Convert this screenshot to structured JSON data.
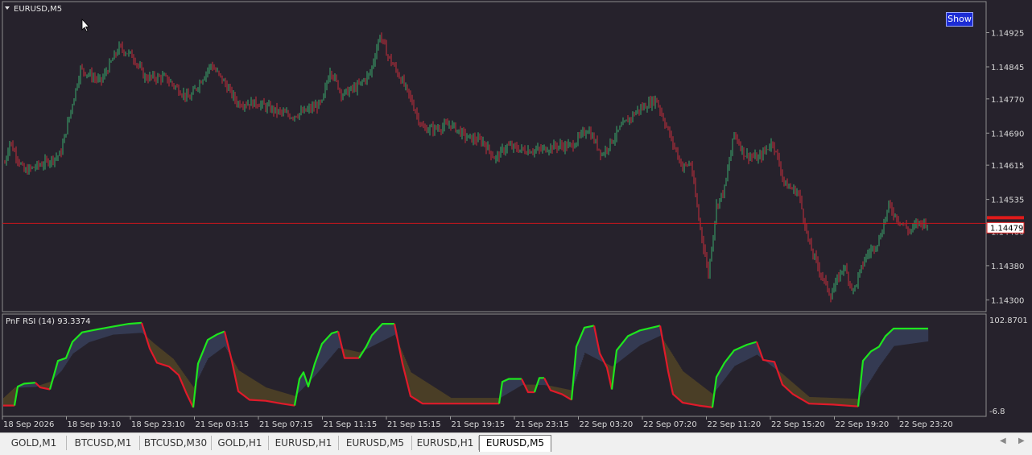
{
  "chart_title": "EURUSD,M5",
  "show_button_label": "Show",
  "indicator_label": "PnF RSI (14) 93.3374",
  "current_price_label": "1.14479",
  "colors": {
    "background": "#26222c",
    "candle_up": "#3aa86b",
    "candle_down": "#c62d3b",
    "price_line": "#c8161d",
    "rsi_up": "#1ee61e",
    "rsi_down": "#e01a2a",
    "fill_up": "#343a52",
    "fill_down": "#4a3e26"
  },
  "chart_data": [
    {
      "type": "candlestick",
      "price_axis_ticks": [
        "1.14925",
        "1.14845",
        "1.14770",
        "1.14690",
        "1.14615",
        "1.14535",
        "1.14460",
        "1.14380",
        "1.14300"
      ],
      "ylim": [
        1.1428,
        1.1499
      ],
      "current_price": 1.14479,
      "x_ticks": [
        "18 Sep 2026",
        "18 Sep 19:10",
        "18 Sep 23:10",
        "21 Sep 03:15",
        "21 Sep 07:15",
        "21 Sep 11:15",
        "21 Sep 15:15",
        "21 Sep 19:15",
        "21 Sep 23:15",
        "22 Sep 03:20",
        "22 Sep 07:20",
        "22 Sep 11:20",
        "22 Sep 15:20",
        "22 Sep 19:20",
        "22 Sep 23:20"
      ],
      "path": [
        [
          0,
          1.1457
        ],
        [
          12,
          1.1467
        ],
        [
          30,
          1.146
        ],
        [
          55,
          1.1462
        ],
        [
          75,
          1.1464
        ],
        [
          100,
          1.1484
        ],
        [
          125,
          1.1481
        ],
        [
          148,
          1.1489
        ],
        [
          165,
          1.1487
        ],
        [
          180,
          1.1482
        ],
        [
          205,
          1.1482
        ],
        [
          235,
          1.1477
        ],
        [
          262,
          1.1485
        ],
        [
          278,
          1.1481
        ],
        [
          295,
          1.1476
        ],
        [
          320,
          1.1476
        ],
        [
          345,
          1.1474
        ],
        [
          362,
          1.1473
        ],
        [
          378,
          1.1474
        ],
        [
          400,
          1.1476
        ],
        [
          410,
          1.1484
        ],
        [
          425,
          1.1478
        ],
        [
          445,
          1.148
        ],
        [
          460,
          1.1483
        ],
        [
          472,
          1.1492
        ],
        [
          482,
          1.1487
        ],
        [
          500,
          1.1481
        ],
        [
          510,
          1.1477
        ],
        [
          525,
          1.147
        ],
        [
          540,
          1.147
        ],
        [
          560,
          1.1471
        ],
        [
          580,
          1.1468
        ],
        [
          600,
          1.1467
        ],
        [
          615,
          1.1463
        ],
        [
          630,
          1.1466
        ],
        [
          650,
          1.1465
        ],
        [
          670,
          1.1465
        ],
        [
          690,
          1.1466
        ],
        [
          710,
          1.1466
        ],
        [
          730,
          1.147
        ],
        [
          748,
          1.1464
        ],
        [
          770,
          1.147
        ],
        [
          790,
          1.1474
        ],
        [
          815,
          1.1477
        ],
        [
          835,
          1.1467
        ],
        [
          848,
          1.1461
        ],
        [
          858,
          1.1462
        ],
        [
          868,
          1.1449
        ],
        [
          880,
          1.1436
        ],
        [
          890,
          1.1452
        ],
        [
          900,
          1.1456
        ],
        [
          912,
          1.1469
        ],
        [
          925,
          1.1464
        ],
        [
          942,
          1.1463
        ],
        [
          960,
          1.1467
        ],
        [
          975,
          1.1457
        ],
        [
          992,
          1.1455
        ],
        [
          1005,
          1.1443
        ],
        [
          1020,
          1.1436
        ],
        [
          1032,
          1.1431
        ],
        [
          1048,
          1.1438
        ],
        [
          1060,
          1.1432
        ],
        [
          1075,
          1.144
        ],
        [
          1092,
          1.1444
        ],
        [
          1104,
          1.1452
        ],
        [
          1115,
          1.1449
        ],
        [
          1130,
          1.1446
        ],
        [
          1140,
          1.1448
        ],
        [
          1152,
          1.1448
        ]
      ]
    },
    {
      "type": "line",
      "title": "PnF RSI (14) 93.3374",
      "y_axis_ticks": [
        "102.8701",
        "-6.8"
      ],
      "ylim": [
        0,
        100
      ],
      "segments": [
        {
          "d": "down",
          "pts": [
            [
              4,
              8
            ],
            [
              18,
              8
            ]
          ]
        },
        {
          "d": "up",
          "pts": [
            [
              18,
              8
            ],
            [
              22,
              28
            ],
            [
              30,
              31
            ],
            [
              44,
              32
            ]
          ]
        },
        {
          "d": "down",
          "pts": [
            [
              44,
              32
            ],
            [
              50,
              27
            ],
            [
              62,
              25
            ]
          ]
        },
        {
          "d": "up",
          "pts": [
            [
              62,
              25
            ],
            [
              72,
              55
            ],
            [
              82,
              58
            ],
            [
              90,
              75
            ],
            [
              102,
              85
            ],
            [
              120,
              88
            ],
            [
              140,
              91
            ],
            [
              160,
              94
            ],
            [
              176,
              95
            ]
          ]
        },
        {
          "d": "down",
          "pts": [
            [
              176,
              95
            ],
            [
              186,
              68
            ],
            [
              195,
              53
            ],
            [
              210,
              49
            ],
            [
              222,
              40
            ],
            [
              232,
              20
            ],
            [
              240,
              6
            ]
          ]
        },
        {
          "d": "up",
          "pts": [
            [
              240,
              6
            ],
            [
              246,
              52
            ],
            [
              258,
              77
            ],
            [
              270,
              83
            ],
            [
              279,
              86
            ]
          ]
        },
        {
          "d": "down",
          "pts": [
            [
              279,
              86
            ],
            [
              288,
              55
            ],
            [
              296,
              23
            ],
            [
              310,
              14
            ],
            [
              330,
              13
            ],
            [
              350,
              10
            ],
            [
              366,
              8
            ]
          ]
        },
        {
          "d": "up",
          "pts": [
            [
              366,
              8
            ],
            [
              372,
              36
            ],
            [
              377,
              43
            ],
            [
              383,
              28
            ],
            [
              391,
              52
            ],
            [
              400,
              73
            ],
            [
              412,
              84
            ],
            [
              420,
              86
            ]
          ]
        },
        {
          "d": "down",
          "pts": [
            [
              420,
              86
            ],
            [
              428,
              58
            ],
            [
              446,
              58
            ]
          ]
        },
        {
          "d": "up",
          "pts": [
            [
              446,
              58
            ],
            [
              455,
              70
            ],
            [
              462,
              82
            ],
            [
              475,
              94
            ],
            [
              490,
              94
            ]
          ]
        },
        {
          "d": "down",
          "pts": [
            [
              490,
              94
            ],
            [
              500,
              52
            ],
            [
              510,
              18
            ],
            [
              525,
              10
            ],
            [
              560,
              10
            ],
            [
              590,
              10
            ],
            [
              620,
              10
            ]
          ]
        },
        {
          "d": "up",
          "pts": [
            [
              620,
              10
            ],
            [
              624,
              33
            ],
            [
              632,
              36
            ],
            [
              648,
              36
            ]
          ]
        },
        {
          "d": "down",
          "pts": [
            [
              648,
              36
            ],
            [
              656,
              22
            ],
            [
              664,
              22
            ]
          ]
        },
        {
          "d": "up",
          "pts": [
            [
              664,
              22
            ],
            [
              670,
              37
            ],
            [
              676,
              37
            ]
          ]
        },
        {
          "d": "down",
          "pts": [
            [
              676,
              37
            ],
            [
              684,
              24
            ],
            [
              698,
              20
            ],
            [
              710,
              14
            ]
          ]
        },
        {
          "d": "up",
          "pts": [
            [
              710,
              14
            ],
            [
              716,
              70
            ],
            [
              726,
              90
            ],
            [
              738,
              92
            ]
          ]
        },
        {
          "d": "down",
          "pts": [
            [
              738,
              92
            ],
            [
              745,
              63
            ],
            [
              754,
              48
            ],
            [
              760,
              25
            ]
          ]
        },
        {
          "d": "up",
          "pts": [
            [
              760,
              25
            ],
            [
              766,
              66
            ],
            [
              780,
              81
            ],
            [
              795,
              87
            ],
            [
              820,
              92
            ]
          ]
        },
        {
          "d": "down",
          "pts": [
            [
              820,
              92
            ],
            [
              830,
              44
            ],
            [
              836,
              20
            ],
            [
              848,
              11
            ],
            [
              868,
              8
            ],
            [
              885,
              6
            ]
          ]
        },
        {
          "d": "up",
          "pts": [
            [
              885,
              6
            ],
            [
              890,
              38
            ],
            [
              900,
              53
            ],
            [
              912,
              66
            ],
            [
              928,
              72
            ],
            [
              940,
              75
            ]
          ]
        },
        {
          "d": "down",
          "pts": [
            [
              940,
              75
            ],
            [
              948,
              56
            ],
            [
              962,
              54
            ],
            [
              972,
              30
            ],
            [
              985,
              20
            ],
            [
              1005,
              10
            ],
            [
              1035,
              9
            ],
            [
              1066,
              7
            ]
          ]
        },
        {
          "d": "up",
          "pts": [
            [
              1066,
              7
            ],
            [
              1072,
              55
            ],
            [
              1082,
              65
            ],
            [
              1092,
              70
            ],
            [
              1100,
              81
            ],
            [
              1110,
              89
            ],
            [
              1153,
              89
            ]
          ]
        }
      ],
      "band": [
        [
          4,
          16
        ],
        [
          18,
          27
        ],
        [
          44,
          28
        ],
        [
          62,
          33
        ],
        [
          76,
          45
        ],
        [
          90,
          63
        ],
        [
          110,
          75
        ],
        [
          140,
          83
        ],
        [
          176,
          85
        ],
        [
          190,
          74
        ],
        [
          215,
          57
        ],
        [
          240,
          27
        ],
        [
          258,
          58
        ],
        [
          279,
          71
        ],
        [
          296,
          45
        ],
        [
          330,
          27
        ],
        [
          366,
          18
        ],
        [
          391,
          40
        ],
        [
          420,
          69
        ],
        [
          446,
          64
        ],
        [
          490,
          83
        ],
        [
          510,
          43
        ],
        [
          560,
          16
        ],
        [
          620,
          16
        ],
        [
          648,
          30
        ],
        [
          676,
          30
        ],
        [
          710,
          24
        ],
        [
          726,
          64
        ],
        [
          760,
          49
        ],
        [
          795,
          72
        ],
        [
          820,
          82
        ],
        [
          848,
          44
        ],
        [
          885,
          20
        ],
        [
          912,
          50
        ],
        [
          940,
          62
        ],
        [
          972,
          41
        ],
        [
          1005,
          17
        ],
        [
          1066,
          15
        ],
        [
          1092,
          50
        ],
        [
          1110,
          71
        ],
        [
          1153,
          76
        ]
      ]
    }
  ],
  "tabs": [
    {
      "label": "GOLD,M1",
      "active": false
    },
    {
      "label": "BTCUSD,M1",
      "active": false
    },
    {
      "label": "BTCUSD,M30",
      "active": false
    },
    {
      "label": "GOLD,H1",
      "active": false
    },
    {
      "label": "EURUSD,H1",
      "active": false
    },
    {
      "label": "EURUSD,M5",
      "active": false
    },
    {
      "label": "EURUSD,H1",
      "active": false
    },
    {
      "label": "EURUSD,M5",
      "active": true
    }
  ],
  "nav_icons": [
    "chevron-left-icon",
    "chevron-right-icon"
  ]
}
